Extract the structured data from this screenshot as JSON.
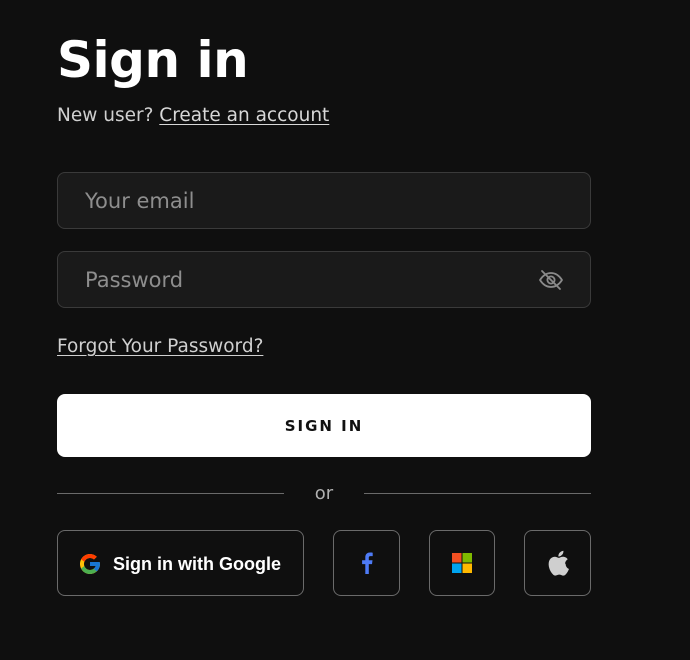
{
  "page": {
    "title": "Sign in",
    "new_user_text": "New user?",
    "create_account_link": "Create an account"
  },
  "form": {
    "email": {
      "value": "",
      "placeholder": "Your email"
    },
    "password": {
      "value": "",
      "placeholder": "Password"
    },
    "password_toggle_icon": "eye-off-icon",
    "forgot_link": "Forgot Your Password?",
    "submit_label": "SIGN IN"
  },
  "divider": {
    "text": "or"
  },
  "social": {
    "google_label": "Sign in with Google",
    "google_icon": "google-icon",
    "facebook_icon": "facebook-icon",
    "microsoft_icon": "microsoft-icon",
    "apple_icon": "apple-icon"
  },
  "colors": {
    "background": "#0f0f0f",
    "field_background": "#1a1a1a",
    "primary_button": "#ffffff",
    "facebook_blue": "#4e7bf6",
    "microsoft_red": "#f25022",
    "microsoft_green": "#7fba00",
    "microsoft_blue": "#00a4ef",
    "microsoft_yellow": "#ffb900"
  }
}
